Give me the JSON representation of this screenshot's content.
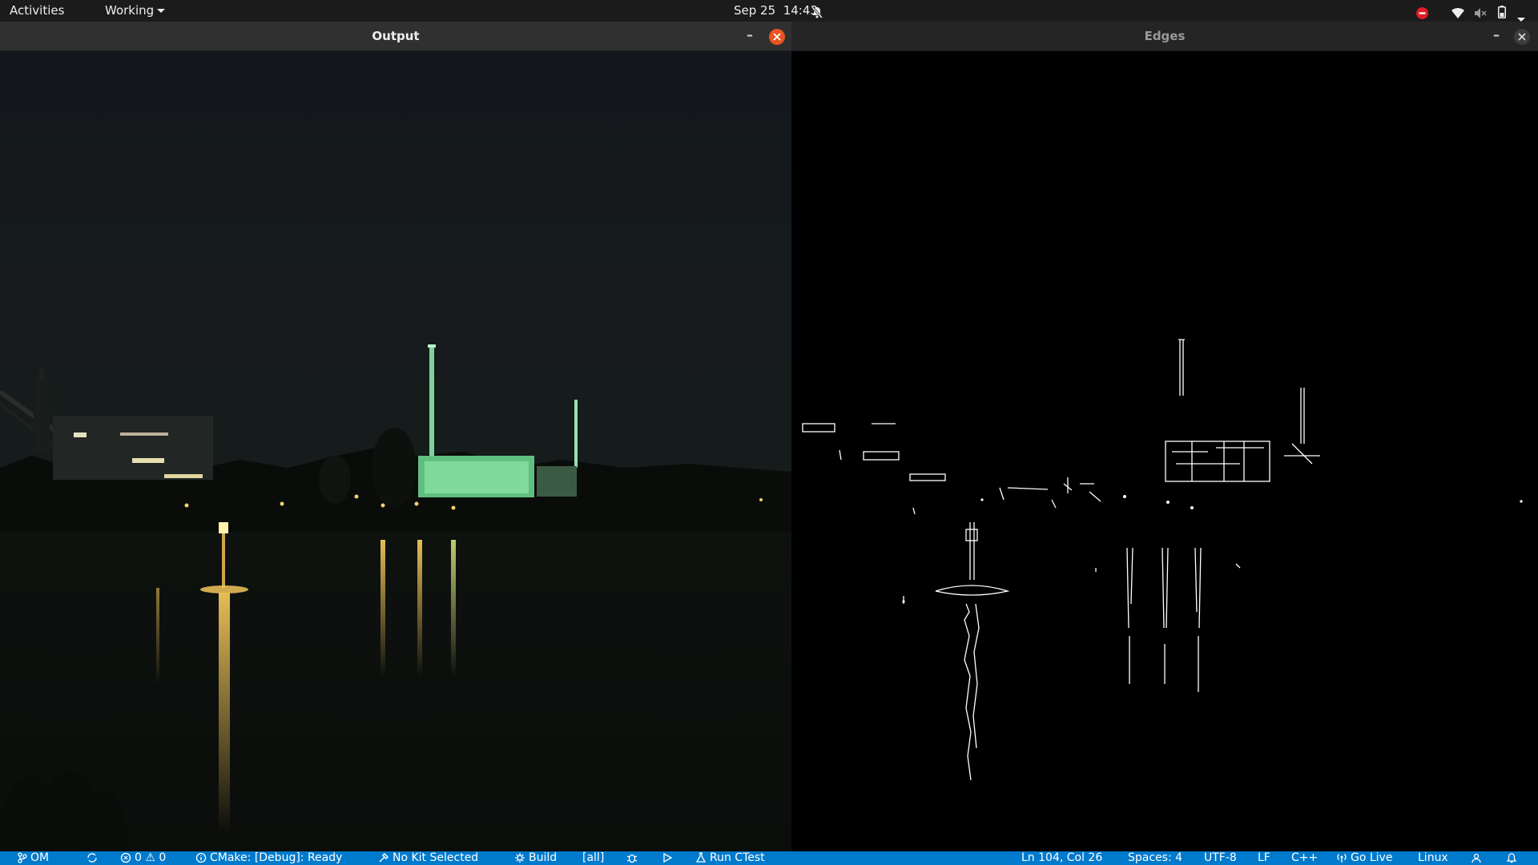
{
  "topbar": {
    "activities": "Activities",
    "workspace_menu": "Working",
    "date": "Sep 25",
    "time": "14:43"
  },
  "windows": {
    "output": {
      "title": "Output",
      "minimize": "–"
    },
    "edges": {
      "title": "Edges",
      "minimize": "–"
    }
  },
  "statusbar": {
    "branch": "OM",
    "problems": "0 ⚠ 0",
    "cmake": "CMake: [Debug]: Ready",
    "kit": "No Kit Selected",
    "build": "Build",
    "target": "[all]",
    "ctest": "Run CTest",
    "cursor": "Ln 104, Col 26",
    "spaces": "Spaces: 4",
    "encoding": "UTF-8",
    "eol": "LF",
    "language": "C++",
    "golive": "Go Live",
    "platform": "Linux"
  },
  "icons": {
    "notifications_off": "bell-off-icon",
    "dnd": "do-not-disturb-icon",
    "wifi": "wifi-icon",
    "volume": "volume-muted-icon",
    "battery": "battery-icon",
    "system_menu": "chevron-down-icon"
  },
  "colors": {
    "topbar": "#1b1b1b",
    "close_active": "#e95420",
    "statusbar": "#007acc",
    "dnd": "#e01b24",
    "chimney_light": "#7fd39a",
    "lamp_light": "#f2c65a"
  }
}
